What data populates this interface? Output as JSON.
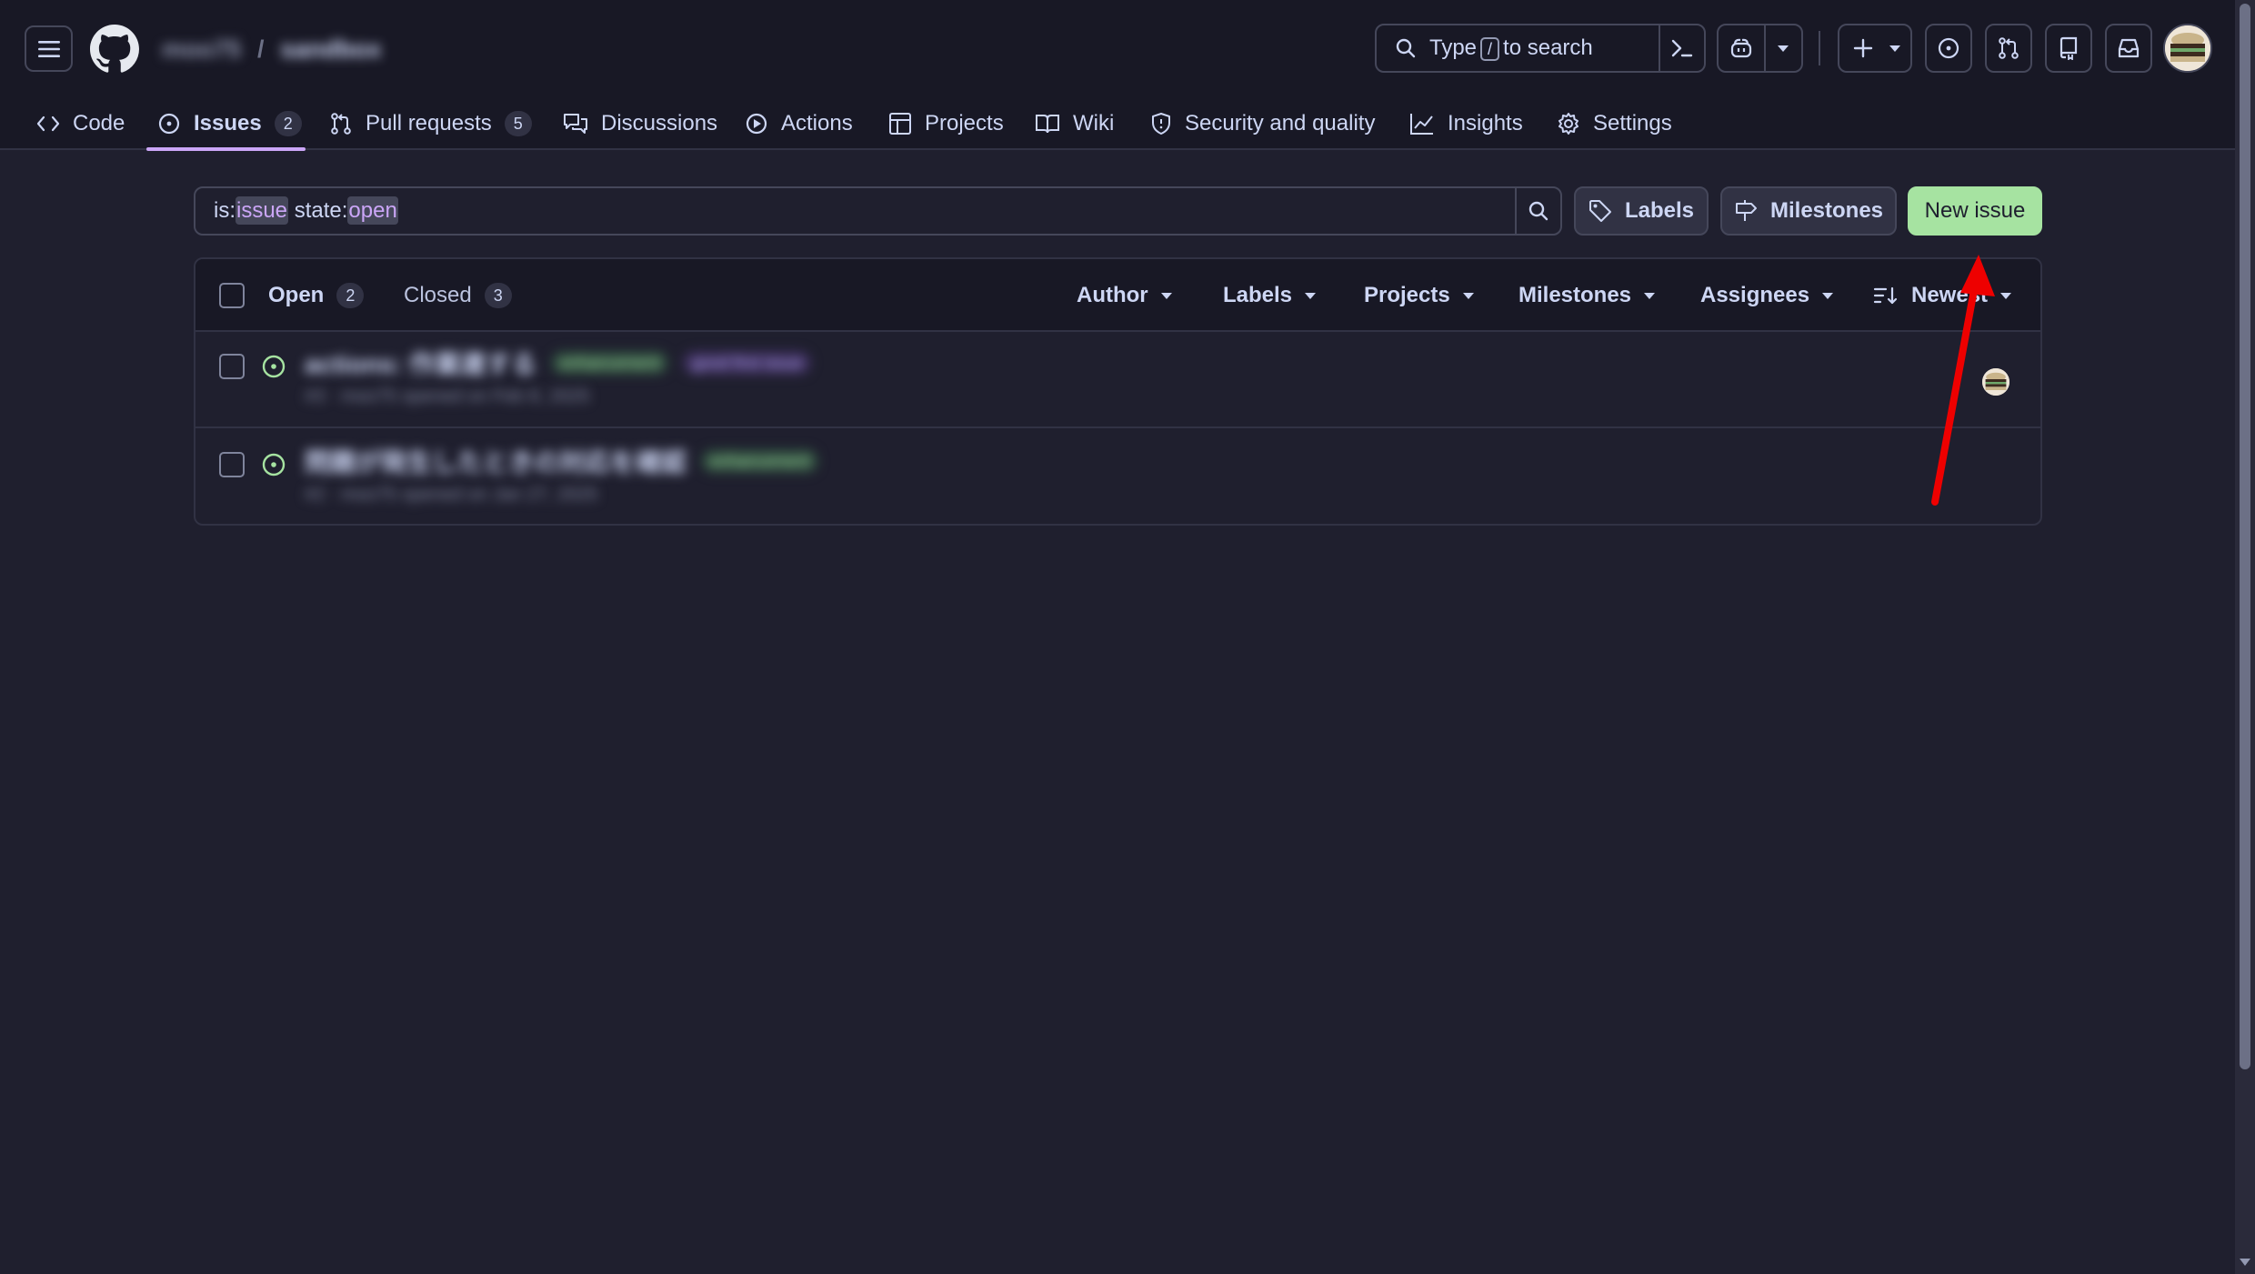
{
  "header": {
    "breadcrumb": {
      "owner": "moo75",
      "separator": "/",
      "repo": "sandbox"
    },
    "search": {
      "prefix": "Type",
      "key": "/",
      "suffix": "to search"
    }
  },
  "repo_nav": {
    "tabs": [
      {
        "label": "Code",
        "icon": "code-icon"
      },
      {
        "label": "Issues",
        "icon": "issue-opened-icon",
        "count": "2",
        "active": true
      },
      {
        "label": "Pull requests",
        "icon": "git-pull-request-icon",
        "count": "5"
      },
      {
        "label": "Discussions",
        "icon": "comment-discussion-icon"
      },
      {
        "label": "Actions",
        "icon": "play-icon"
      },
      {
        "label": "Projects",
        "icon": "table-icon"
      },
      {
        "label": "Wiki",
        "icon": "book-icon"
      },
      {
        "label": "Security and quality",
        "icon": "shield-icon"
      },
      {
        "label": "Insights",
        "icon": "graph-icon"
      },
      {
        "label": "Settings",
        "icon": "gear-icon"
      }
    ]
  },
  "filter": {
    "q1_key": "is:",
    "q1_val": "issue",
    "q2_key": "state:",
    "q2_val": "open",
    "labels_button": "Labels",
    "milestones_button": "Milestones",
    "new_issue_button": "New issue"
  },
  "issues_list": {
    "open_label": "Open",
    "open_count": "2",
    "closed_label": "Closed",
    "closed_count": "3",
    "filters": [
      "Author",
      "Labels",
      "Projects",
      "Milestones",
      "Assignees",
      "Newest"
    ],
    "items": [
      {
        "title": "actions: 作業連する",
        "labels": [
          "enhancement",
          "good first issue"
        ],
        "meta": "#3 · moo75 opened on Feb 8, 2025"
      },
      {
        "title": "問題が発生したときの対応を確認",
        "labels": [
          "enhancement"
        ],
        "meta": "#2 · moo75 opened on Jan 27, 2025"
      }
    ]
  },
  "colors": {
    "accent": "#cba6f7",
    "primary_button": "#a6e3a1",
    "open_issue": "#a6e3a1",
    "annotation_arrow": "#ee0000"
  }
}
